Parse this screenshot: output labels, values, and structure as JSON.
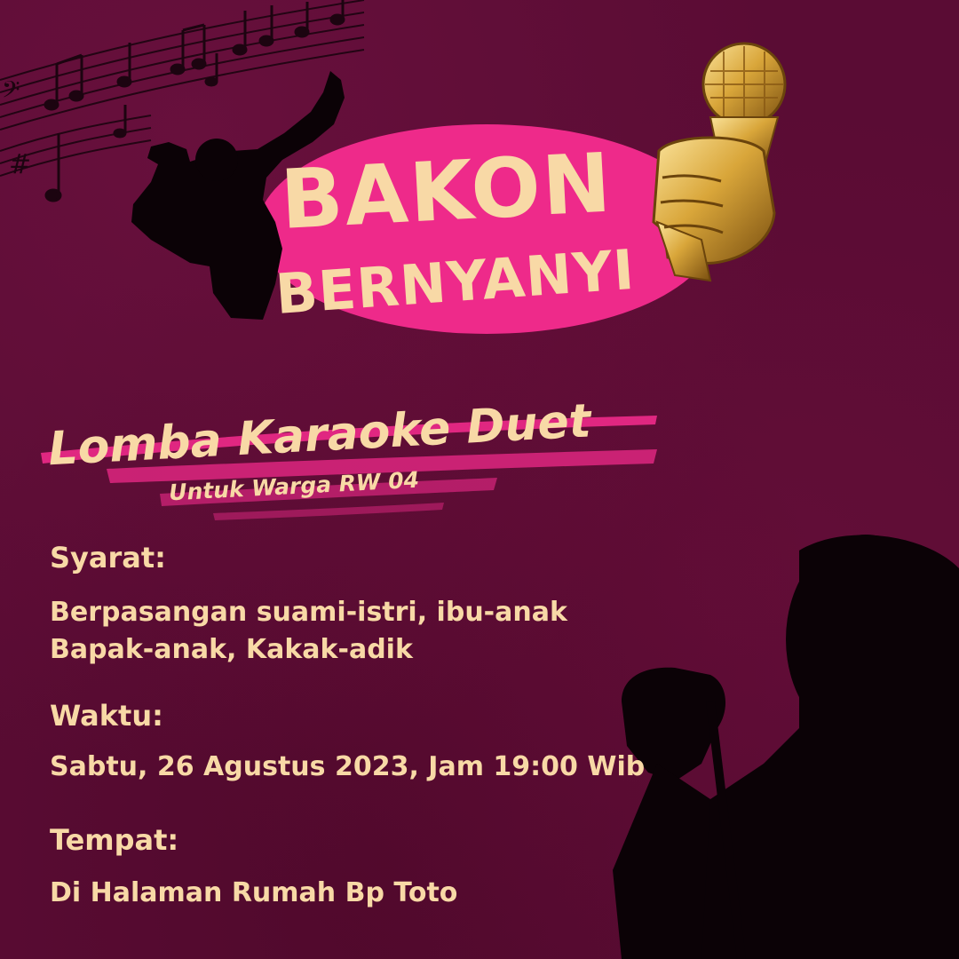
{
  "title": {
    "line1": "BAKON",
    "line2": "BERNYANYI"
  },
  "event": {
    "headline": "Lomba Karaoke Duet",
    "subheadline": "Untuk Warga RW 04"
  },
  "syarat": {
    "label": "Syarat:",
    "line1": "Berpasangan suami-istri, ibu-anak",
    "line2": "Bapak-anak, Kakak-adik"
  },
  "waktu": {
    "label": "Waktu:",
    "value": "Sabtu, 26 Agustus 2023, Jam 19:00 Wib"
  },
  "tempat": {
    "label": "Tempat:",
    "value": "Di Halaman Rumah Bp Toto"
  },
  "colors": {
    "background": "#5a0c34",
    "accent_pink": "#ee2a8a",
    "text_cream": "#f8d9a6",
    "gold": "#d9a63a"
  },
  "icons": [
    "music-notes-icon",
    "singer-silhouette-icon",
    "golden-microphone-icon",
    "singer-silhouette-large-icon"
  ]
}
